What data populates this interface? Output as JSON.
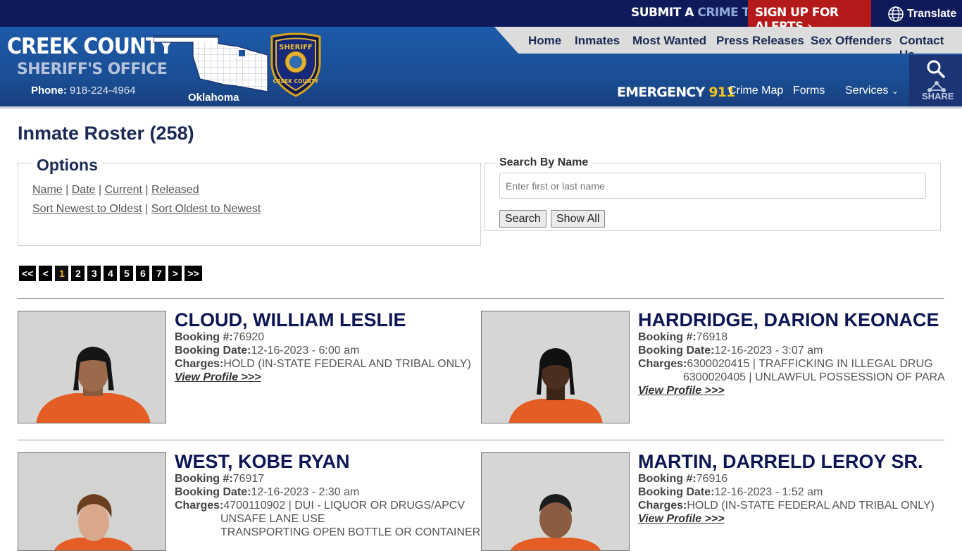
{
  "topbar": {
    "crime_tip_prefix": "SUBMIT A",
    "crime_tip_accent": "CRIME TIP",
    "alerts_label": "SIGN UP FOR ALERTS",
    "translate_label": "Translate"
  },
  "header": {
    "brand_line1": "CREEK COUNTY",
    "brand_line2": "SHERIFF'S OFFICE",
    "phone_label": "Phone:",
    "phone_number": "918-224-4964",
    "map_label": "Oklahoma",
    "badge_top": "SHERIFF",
    "badge_bottom": "CREEK COUNTY",
    "nav": [
      "Home",
      "Inmates",
      "Most Wanted",
      "Press Releases",
      "Sex Offenders",
      "Contact Us"
    ],
    "emergency_label": "EMERGENCY",
    "emergency_number": "911",
    "subnav": [
      "Crime Map",
      "Forms",
      "Services"
    ],
    "share_label": "SHARE"
  },
  "page_title": "Inmate Roster (258)",
  "options": {
    "legend": "Options",
    "filter_links": [
      "Name",
      "Date",
      "Current",
      "Released"
    ],
    "sort_links": [
      "Sort Newest to Oldest",
      "Sort Oldest to Newest"
    ]
  },
  "search": {
    "legend": "Search By Name",
    "placeholder": "Enter first or last name",
    "search_button": "Search",
    "show_all_button": "Show All"
  },
  "pager": [
    "<<",
    "<",
    "1",
    "2",
    "3",
    "4",
    "5",
    "6",
    "7",
    ">",
    ">>"
  ],
  "pager_active": "1",
  "labels": {
    "booking_no": "Booking #:",
    "booking_date": "Booking Date:",
    "charges": "Charges:",
    "view_profile": "View Profile >>>"
  },
  "inmates": [
    {
      "name": "CLOUD, WILLIAM LESLIE",
      "booking_no": "76920",
      "booking_date": "12-16-2023 - 6:00 am",
      "charges": [
        "HOLD (IN-STATE FEDERAL AND TRIBAL ONLY)"
      ]
    },
    {
      "name": "HARDRIDGE, DARION KEONACE",
      "booking_no": "76918",
      "booking_date": "12-16-2023 - 3:07 am",
      "charges": [
        "6300020415 | TRAFFICKING IN ILLEGAL DRUG",
        "6300020405 | UNLAWFUL POSSESSION OF PARA"
      ]
    },
    {
      "name": "WEST, KOBE RYAN",
      "booking_no": "76917",
      "booking_date": "12-16-2023 - 2:30 am",
      "charges": [
        "4700110902 | DUI - LIQUOR OR DRUGS/APCV",
        "UNSAFE LANE USE",
        "TRANSPORTING OPEN BOTTLE OR CONTAINER -"
      ]
    },
    {
      "name": "MARTIN, DARRELD LEROY SR.",
      "booking_no": "76916",
      "booking_date": "12-16-2023 - 1:52 am",
      "charges": [
        "HOLD (IN-STATE FEDERAL AND TRIBAL ONLY)"
      ]
    }
  ]
}
